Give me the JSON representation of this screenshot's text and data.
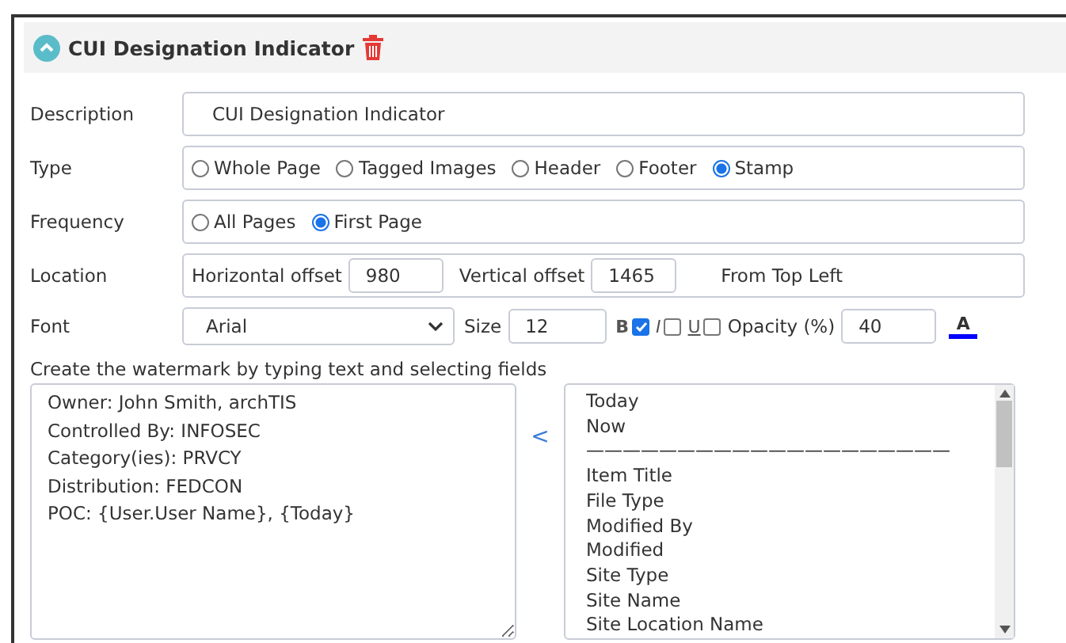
{
  "section": {
    "title": "CUI Designation Indicator",
    "expanded": true
  },
  "description": {
    "label": "Description",
    "value": "CUI Designation Indicator"
  },
  "type": {
    "label": "Type",
    "options": [
      {
        "label": "Whole Page",
        "selected": false
      },
      {
        "label": "Tagged Images",
        "selected": false
      },
      {
        "label": "Header",
        "selected": false
      },
      {
        "label": "Footer",
        "selected": false
      },
      {
        "label": "Stamp",
        "selected": true
      }
    ]
  },
  "frequency": {
    "label": "Frequency",
    "options": [
      {
        "label": "All Pages",
        "selected": false
      },
      {
        "label": "First Page",
        "selected": true
      }
    ]
  },
  "location": {
    "label": "Location",
    "horizontal_label": "Horizontal offset",
    "horizontal_value": "980",
    "vertical_label": "Vertical offset",
    "vertical_value": "1465",
    "origin": "From Top Left"
  },
  "font": {
    "label": "Font",
    "family": "Arial",
    "size_label": "Size",
    "size": "12",
    "bold_label": "B",
    "bold": true,
    "italic_label": "I",
    "italic": false,
    "underline_label": "U",
    "underline": false,
    "opacity_label": "Opacity (%)",
    "opacity": "40",
    "color_label": "A",
    "color": "#0000ff"
  },
  "watermark": {
    "instructions": "Create the watermark by typing text and selecting fields",
    "text": "Owner: John Smith, archTIS\nControlled By: INFOSEC\nCategory(ies): PRVCY\nDistribution: FEDCON\nPOC: {User.User Name}, {Today}",
    "insert_symbol": "<",
    "fields": [
      "Today",
      "Now",
      "————————————————————",
      "Item Title",
      "File Type",
      "Modified By",
      "Modified",
      "Site Type",
      "Site Name",
      "Site Location Name"
    ]
  }
}
